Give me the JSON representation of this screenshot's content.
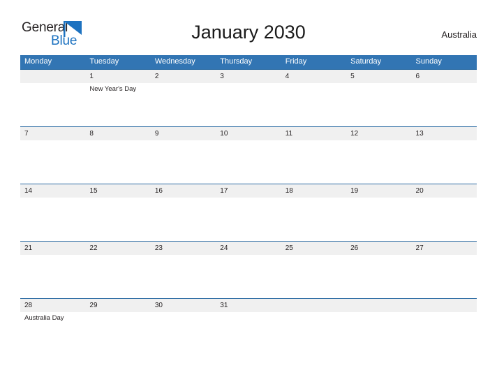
{
  "brand": {
    "name_part1": "General",
    "name_part2": "Blue",
    "flag_icon": "blue-flag-triangle-icon",
    "color_dark": "#231f20",
    "color_blue": "#1d72c0"
  },
  "header": {
    "title": "January 2030",
    "region": "Australia"
  },
  "calendar": {
    "month": "January",
    "year": "2030",
    "header_bg": "#3275b3",
    "daynum_bg": "#f0f0f0",
    "rule_color": "#2e6da4",
    "weekdays": [
      "Monday",
      "Tuesday",
      "Wednesday",
      "Thursday",
      "Friday",
      "Saturday",
      "Sunday"
    ],
    "weeks": [
      [
        {
          "date": "",
          "event": ""
        },
        {
          "date": "1",
          "event": "New Year's Day"
        },
        {
          "date": "2",
          "event": ""
        },
        {
          "date": "3",
          "event": ""
        },
        {
          "date": "4",
          "event": ""
        },
        {
          "date": "5",
          "event": ""
        },
        {
          "date": "6",
          "event": ""
        }
      ],
      [
        {
          "date": "7",
          "event": ""
        },
        {
          "date": "8",
          "event": ""
        },
        {
          "date": "9",
          "event": ""
        },
        {
          "date": "10",
          "event": ""
        },
        {
          "date": "11",
          "event": ""
        },
        {
          "date": "12",
          "event": ""
        },
        {
          "date": "13",
          "event": ""
        }
      ],
      [
        {
          "date": "14",
          "event": ""
        },
        {
          "date": "15",
          "event": ""
        },
        {
          "date": "16",
          "event": ""
        },
        {
          "date": "17",
          "event": ""
        },
        {
          "date": "18",
          "event": ""
        },
        {
          "date": "19",
          "event": ""
        },
        {
          "date": "20",
          "event": ""
        }
      ],
      [
        {
          "date": "21",
          "event": ""
        },
        {
          "date": "22",
          "event": ""
        },
        {
          "date": "23",
          "event": ""
        },
        {
          "date": "24",
          "event": ""
        },
        {
          "date": "25",
          "event": ""
        },
        {
          "date": "26",
          "event": ""
        },
        {
          "date": "27",
          "event": ""
        }
      ],
      [
        {
          "date": "28",
          "event": "Australia Day"
        },
        {
          "date": "29",
          "event": ""
        },
        {
          "date": "30",
          "event": ""
        },
        {
          "date": "31",
          "event": ""
        },
        {
          "date": "",
          "event": ""
        },
        {
          "date": "",
          "event": ""
        },
        {
          "date": "",
          "event": ""
        }
      ]
    ]
  }
}
